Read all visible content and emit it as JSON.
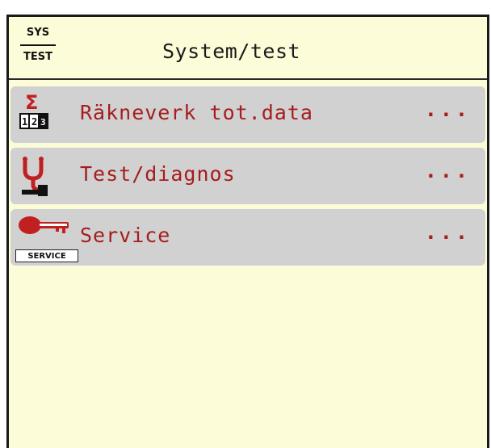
{
  "header": {
    "icon_top": "SYS",
    "icon_bottom": "TEST",
    "title": "System/test"
  },
  "menu": {
    "items": [
      {
        "label": "Räkneverk tot.data",
        "more": "...",
        "icon": "sigma-counter-icon"
      },
      {
        "label": "Test/diagnos",
        "more": "...",
        "icon": "stethoscope-icon"
      },
      {
        "label": "Service",
        "more": "...",
        "icon": "key-icon",
        "icon_caption": "SERVICE"
      }
    ]
  },
  "colors": {
    "background": "#fdfcd9",
    "item_background": "#d1d1d1",
    "text_accent": "#a61d1d"
  }
}
